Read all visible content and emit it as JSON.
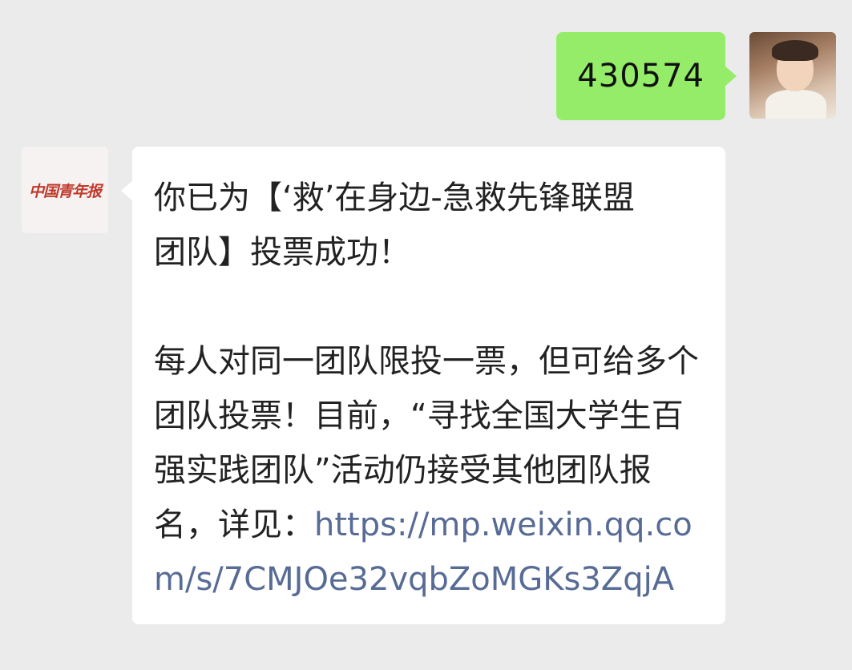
{
  "messages": {
    "outgoing": {
      "text": "430574"
    },
    "incoming": {
      "sender_logo_text": "中国青年报",
      "line1": "你已为【‘救’在身边-急救先锋联盟",
      "line2": "团队】投票成功！",
      "body": "每人对同一团队限投一票，但可给多个团队投票！目前，“寻找全国大学生百强实践团队”活动仍接受其他团队报名，详见：",
      "link": "https://mp.weixin.qq.com/s/7CMJOe32vqbZoMGKs3ZqjA"
    }
  },
  "colors": {
    "background": "#ebebeb",
    "outgoing_bubble": "#95ec69",
    "incoming_bubble": "#ffffff",
    "link": "#576b95",
    "logo_red": "#c0392b"
  },
  "icons": {
    "user_avatar": "avatar-photo",
    "sender_avatar": "china-youth-daily-logo"
  }
}
